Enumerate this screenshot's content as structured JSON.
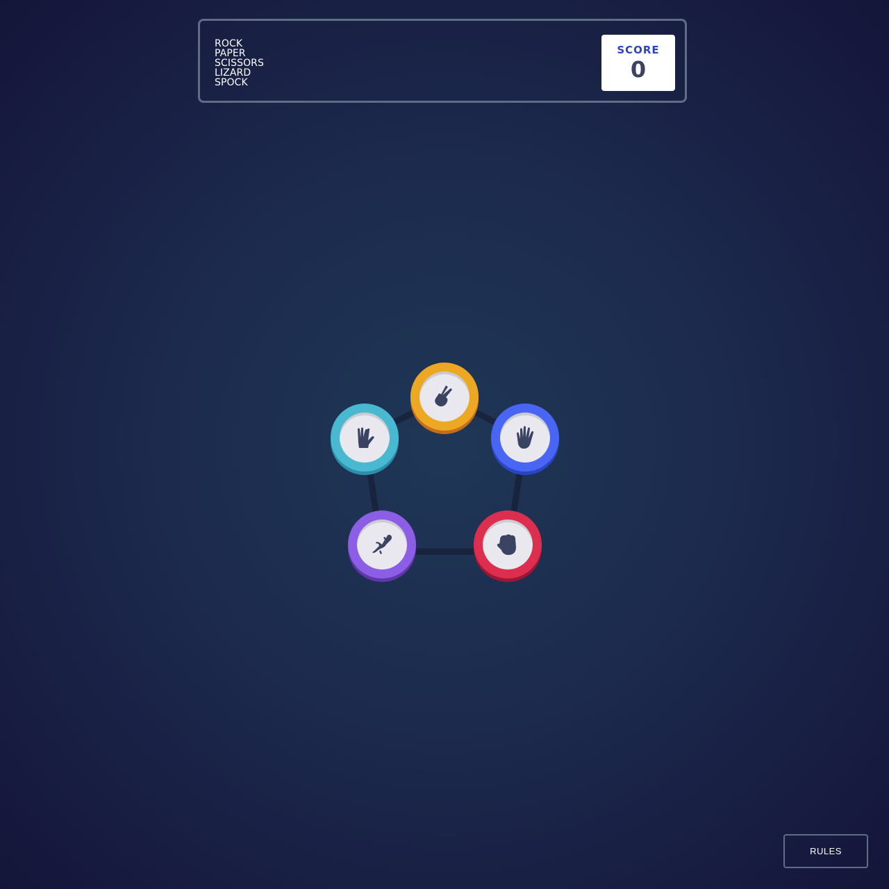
{
  "header": {
    "title_lines": [
      "ROCK",
      "PAPER",
      "SCISSORS",
      "LIZARD",
      "SPOCK"
    ],
    "score_label": "SCORE",
    "score_value": "0"
  },
  "choices": [
    {
      "id": "scissors",
      "icon": "scissors-hand-icon",
      "color": "#eca822"
    },
    {
      "id": "paper",
      "icon": "paper-hand-icon",
      "color": "#4865f4"
    },
    {
      "id": "rock",
      "icon": "rock-fist-icon",
      "color": "#dc2e4e"
    },
    {
      "id": "lizard",
      "icon": "lizard-icon",
      "color": "#8c5de5"
    },
    {
      "id": "spock",
      "icon": "spock-hand-icon",
      "color": "#48b9d1"
    }
  ],
  "footer": {
    "rules_label": "RULES"
  }
}
